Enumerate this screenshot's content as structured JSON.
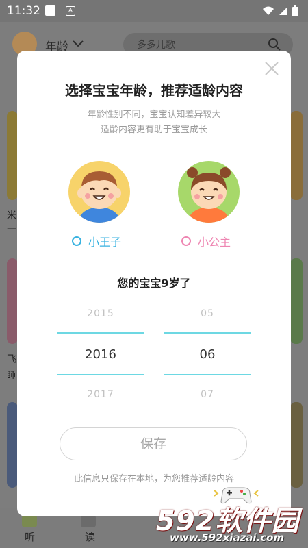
{
  "status_bar": {
    "time": "11:32",
    "indicator": "A"
  },
  "background": {
    "age_label": "年龄",
    "search_placeholder": "多多儿歌",
    "left_snippets": [
      "米",
      "—",
      "飞",
      "睡"
    ],
    "nav": [
      "听",
      "读"
    ]
  },
  "dialog": {
    "title": "选择宝宝年龄，推荐适龄内容",
    "subtitle_line1": "年龄性别不同，宝宝认知差异较大",
    "subtitle_line2": "适龄内容更有助于宝宝成长",
    "genders": [
      {
        "label": "小王子",
        "color": "#38b2e0"
      },
      {
        "label": "小公主",
        "color": "#ee86b2"
      }
    ],
    "age_text": "您的宝宝9岁了",
    "year_picker": {
      "above": "2015",
      "selected": "2016",
      "below": "2017"
    },
    "month_picker": {
      "above": "05",
      "selected": "06",
      "below": "07"
    },
    "save_label": "保存",
    "note": "此信息只保存在本地，为您推荐适龄内容"
  },
  "watermark": {
    "brand": "592软件园",
    "url": "www.592xiazai.com"
  },
  "colors": {
    "accent": "#6dd8e3",
    "boy": "#38b2e0",
    "girl": "#ee86b2"
  }
}
